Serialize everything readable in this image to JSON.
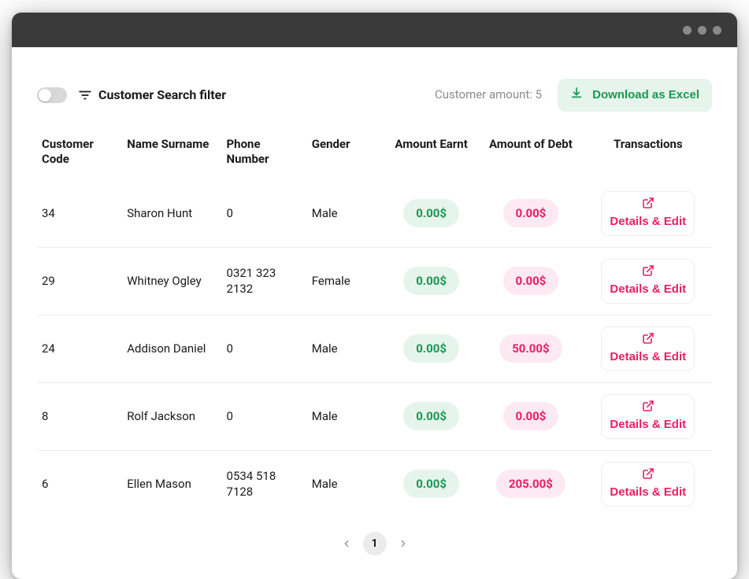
{
  "topbar": {
    "filter_label": "Customer Search filter",
    "customer_amount_label": "Customer amount: 5",
    "download_label": "Download as Excel"
  },
  "columns": {
    "code": "Customer Code",
    "name": "Name Surname",
    "phone": "Phone Number",
    "gender": "Gender",
    "earnt": "Amount Earnt",
    "debt": "Amount of Debt",
    "transactions": "Transactions"
  },
  "rows": [
    {
      "code": "34",
      "name": "Sharon Hunt",
      "phone": "0",
      "gender": "Male",
      "earnt": "0.00$",
      "debt": "0.00$",
      "action": "Details & Edit"
    },
    {
      "code": "29",
      "name": "Whitney Ogley",
      "phone": "0321 323 2132",
      "gender": "Female",
      "earnt": "0.00$",
      "debt": "0.00$",
      "action": "Details & Edit"
    },
    {
      "code": "24",
      "name": "Addison Daniel",
      "phone": "0",
      "gender": "Male",
      "earnt": "0.00$",
      "debt": "50.00$",
      "action": "Details & Edit"
    },
    {
      "code": "8",
      "name": "Rolf Jackson",
      "phone": "0",
      "gender": "Male",
      "earnt": "0.00$",
      "debt": "0.00$",
      "action": "Details & Edit"
    },
    {
      "code": "6",
      "name": "Ellen Mason",
      "phone": "0534 518 7128",
      "gender": "Male",
      "earnt": "0.00$",
      "debt": "205.00$",
      "action": "Details & Edit"
    }
  ],
  "pagination": {
    "current": "1"
  }
}
